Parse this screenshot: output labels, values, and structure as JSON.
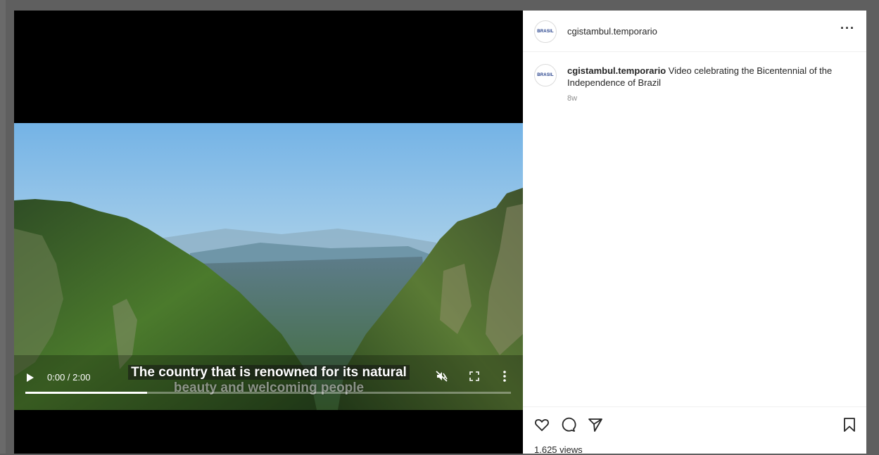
{
  "post": {
    "username": "cgistambul.temporario",
    "avatar_text": "BRASIL",
    "caption": "Video celebrating the Bicentennial of the Independence of Brazil",
    "time_ago": "8w",
    "views_count": "1.625",
    "views_label": "views",
    "options_label": "···"
  },
  "video": {
    "time_display": "0:00 / 2:00",
    "subtitle_line1": "The country that is renowned for its natural",
    "subtitle_line2": "beauty and welcoming people",
    "progress_fraction": 0.25,
    "muted": true
  },
  "icons": {
    "play": "play-icon",
    "mute": "muted-speaker-icon",
    "fullscreen": "fullscreen-icon",
    "more": "vertical-dots-icon",
    "like": "heart-icon",
    "comment": "comment-bubble-icon",
    "share": "paper-plane-icon",
    "save": "bookmark-icon"
  },
  "colors": {
    "overlay": "#5f5f5f",
    "text": "#262626",
    "muted_text": "#8e8e8e",
    "divider": "#efefef"
  }
}
